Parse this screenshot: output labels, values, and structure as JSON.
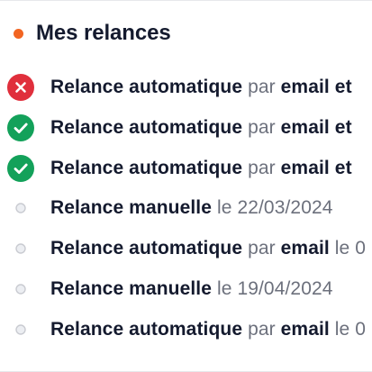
{
  "header": {
    "title": "Mes relances",
    "dot_color": "#f26522"
  },
  "colors": {
    "error": "#e02f3c",
    "success": "#13a15a",
    "pending_border": "#c9cbd1",
    "pending_fill": "#eceef2",
    "text_strong": "#141a2e",
    "text_muted": "#6c707c"
  },
  "items": [
    {
      "status": "error",
      "status_icon": "x-circle-icon",
      "title": "Relance automatique",
      "connector": "par",
      "channel": "email et",
      "date_prefix": "",
      "date": ""
    },
    {
      "status": "success",
      "status_icon": "check-circle-icon",
      "title": "Relance automatique",
      "connector": "par",
      "channel": "email et",
      "date_prefix": "",
      "date": ""
    },
    {
      "status": "success",
      "status_icon": "check-circle-icon",
      "title": "Relance automatique",
      "connector": "par",
      "channel": "email et",
      "date_prefix": "",
      "date": ""
    },
    {
      "status": "pending",
      "status_icon": "empty-circle-icon",
      "title": "Relance manuelle",
      "connector": "",
      "channel": "",
      "date_prefix": "le",
      "date": "22/03/2024"
    },
    {
      "status": "pending",
      "status_icon": "empty-circle-icon",
      "title": "Relance automatique",
      "connector": "par",
      "channel": "email",
      "date_prefix": "le",
      "date": "0"
    },
    {
      "status": "pending",
      "status_icon": "empty-circle-icon",
      "title": "Relance manuelle",
      "connector": "",
      "channel": "",
      "date_prefix": "le",
      "date": "19/04/2024"
    },
    {
      "status": "pending",
      "status_icon": "empty-circle-icon",
      "title": "Relance automatique",
      "connector": "par",
      "channel": "email",
      "date_prefix": "le",
      "date": "0"
    }
  ]
}
